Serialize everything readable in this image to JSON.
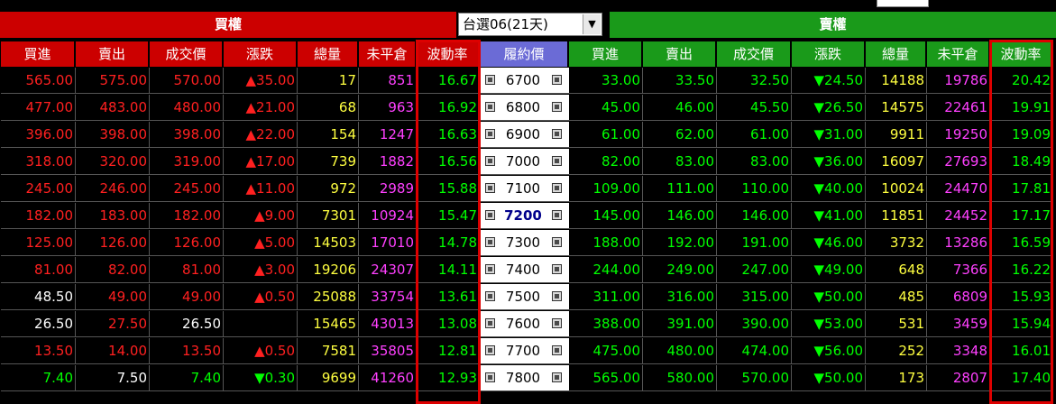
{
  "call_banner": "買權",
  "put_banner": "賣權",
  "expiry_select": {
    "value": "台選06(21天)"
  },
  "headers": {
    "call": [
      "買進",
      "賣出",
      "成交價",
      "漲跌",
      "總量",
      "未平倉",
      "波動率"
    ],
    "strike": "履約價",
    "put": [
      "買進",
      "賣出",
      "成交價",
      "漲跌",
      "總量",
      "未平倉",
      "波動率"
    ]
  },
  "colors": {
    "call_header": "#cc0000",
    "put_header": "#1a9a1a",
    "strike_header": "#6b6bd6",
    "up": "#ff2020",
    "down": "#00ff00",
    "volume": "#ffff40",
    "oi": "#ff40ff",
    "highlight": "#dd0000"
  },
  "atm_strike": "7200",
  "rows": [
    {
      "c_bid": "565.00",
      "c_ask": "575.00",
      "c_last": "570.00",
      "c_chg": "▲35.00",
      "c_vol": "17",
      "c_oi": "851",
      "c_iv": "16.67",
      "strike": "6700",
      "p_bid": "33.00",
      "p_ask": "33.50",
      "p_last": "32.50",
      "p_chg": "▼24.50",
      "p_vol": "14188",
      "p_oi": "19786",
      "p_iv": "20.42"
    },
    {
      "c_bid": "477.00",
      "c_ask": "483.00",
      "c_last": "480.00",
      "c_chg": "▲21.00",
      "c_vol": "68",
      "c_oi": "963",
      "c_iv": "16.92",
      "strike": "6800",
      "p_bid": "45.00",
      "p_ask": "46.00",
      "p_last": "45.50",
      "p_chg": "▼26.50",
      "p_vol": "14575",
      "p_oi": "22461",
      "p_iv": "19.91"
    },
    {
      "c_bid": "396.00",
      "c_ask": "398.00",
      "c_last": "398.00",
      "c_chg": "▲22.00",
      "c_vol": "154",
      "c_oi": "1247",
      "c_iv": "16.63",
      "strike": "6900",
      "p_bid": "61.00",
      "p_ask": "62.00",
      "p_last": "61.00",
      "p_chg": "▼31.00",
      "p_vol": "9911",
      "p_oi": "19250",
      "p_iv": "19.09"
    },
    {
      "c_bid": "318.00",
      "c_ask": "320.00",
      "c_last": "319.00",
      "c_chg": "▲17.00",
      "c_vol": "739",
      "c_oi": "1882",
      "c_iv": "16.56",
      "strike": "7000",
      "p_bid": "82.00",
      "p_ask": "83.00",
      "p_last": "83.00",
      "p_chg": "▼36.00",
      "p_vol": "16097",
      "p_oi": "27693",
      "p_iv": "18.49"
    },
    {
      "c_bid": "245.00",
      "c_ask": "246.00",
      "c_last": "245.00",
      "c_chg": "▲11.00",
      "c_vol": "972",
      "c_oi": "2989",
      "c_iv": "15.88",
      "strike": "7100",
      "p_bid": "109.00",
      "p_ask": "111.00",
      "p_last": "110.00",
      "p_chg": "▼40.00",
      "p_vol": "10024",
      "p_oi": "24470",
      "p_iv": "17.81"
    },
    {
      "c_bid": "182.00",
      "c_ask": "183.00",
      "c_last": "182.00",
      "c_chg": "▲9.00",
      "c_vol": "7301",
      "c_oi": "10924",
      "c_iv": "15.47",
      "strike": "7200",
      "p_bid": "145.00",
      "p_ask": "146.00",
      "p_last": "146.00",
      "p_chg": "▼41.00",
      "p_vol": "11851",
      "p_oi": "24452",
      "p_iv": "17.17"
    },
    {
      "c_bid": "125.00",
      "c_ask": "126.00",
      "c_last": "126.00",
      "c_chg": "▲5.00",
      "c_vol": "14503",
      "c_oi": "17010",
      "c_iv": "14.78",
      "strike": "7300",
      "p_bid": "188.00",
      "p_ask": "192.00",
      "p_last": "191.00",
      "p_chg": "▼46.00",
      "p_vol": "3732",
      "p_oi": "13286",
      "p_iv": "16.59"
    },
    {
      "c_bid": "81.00",
      "c_ask": "82.00",
      "c_last": "81.00",
      "c_chg": "▲3.00",
      "c_vol": "19206",
      "c_oi": "24307",
      "c_iv": "14.11",
      "strike": "7400",
      "p_bid": "244.00",
      "p_ask": "249.00",
      "p_last": "247.00",
      "p_chg": "▼49.00",
      "p_vol": "648",
      "p_oi": "7366",
      "p_iv": "16.22"
    },
    {
      "c_bid": "48.50",
      "c_ask": "49.00",
      "c_last": "49.00",
      "c_chg": "▲0.50",
      "c_vol": "25088",
      "c_oi": "33754",
      "c_iv": "13.61",
      "strike": "7500",
      "p_bid": "311.00",
      "p_ask": "316.00",
      "p_last": "315.00",
      "p_chg": "▼50.00",
      "p_vol": "485",
      "p_oi": "6809",
      "p_iv": "15.93"
    },
    {
      "c_bid": "26.50",
      "c_ask": "27.50",
      "c_last": "26.50",
      "c_chg": "",
      "c_vol": "15465",
      "c_oi": "43013",
      "c_iv": "13.08",
      "strike": "7600",
      "p_bid": "388.00",
      "p_ask": "391.00",
      "p_last": "390.00",
      "p_chg": "▼53.00",
      "p_vol": "531",
      "p_oi": "3459",
      "p_iv": "15.94"
    },
    {
      "c_bid": "13.50",
      "c_ask": "14.00",
      "c_last": "13.50",
      "c_chg": "▲0.50",
      "c_vol": "7581",
      "c_oi": "35805",
      "c_iv": "12.81",
      "strike": "7700",
      "p_bid": "475.00",
      "p_ask": "480.00",
      "p_last": "474.00",
      "p_chg": "▼56.00",
      "p_vol": "252",
      "p_oi": "3348",
      "p_iv": "16.01"
    },
    {
      "c_bid": "7.40",
      "c_ask": "7.50",
      "c_last": "7.40",
      "c_chg": "▼0.30",
      "c_vol": "9699",
      "c_oi": "41260",
      "c_iv": "12.93",
      "strike": "7800",
      "p_bid": "565.00",
      "p_ask": "580.00",
      "p_last": "570.00",
      "p_chg": "▼50.00",
      "p_vol": "173",
      "p_oi": "2807",
      "p_iv": "17.40"
    }
  ],
  "row_colors": [
    {
      "c_bid": "red",
      "c_ask": "red",
      "c_last": "red",
      "c_chg": "red"
    },
    {
      "c_bid": "red",
      "c_ask": "red",
      "c_last": "red",
      "c_chg": "red"
    },
    {
      "c_bid": "red",
      "c_ask": "red",
      "c_last": "red",
      "c_chg": "red"
    },
    {
      "c_bid": "red",
      "c_ask": "red",
      "c_last": "red",
      "c_chg": "red"
    },
    {
      "c_bid": "red",
      "c_ask": "red",
      "c_last": "red",
      "c_chg": "red"
    },
    {
      "c_bid": "red",
      "c_ask": "red",
      "c_last": "red",
      "c_chg": "red"
    },
    {
      "c_bid": "red",
      "c_ask": "red",
      "c_last": "red",
      "c_chg": "red"
    },
    {
      "c_bid": "red",
      "c_ask": "red",
      "c_last": "red",
      "c_chg": "red"
    },
    {
      "c_bid": "white",
      "c_ask": "red",
      "c_last": "red",
      "c_chg": "red"
    },
    {
      "c_bid": "white",
      "c_ask": "red",
      "c_last": "white",
      "c_chg": "white"
    },
    {
      "c_bid": "red",
      "c_ask": "red",
      "c_last": "red",
      "c_chg": "red"
    },
    {
      "c_bid": "green",
      "c_ask": "white",
      "c_last": "green",
      "c_chg": "green"
    }
  ]
}
